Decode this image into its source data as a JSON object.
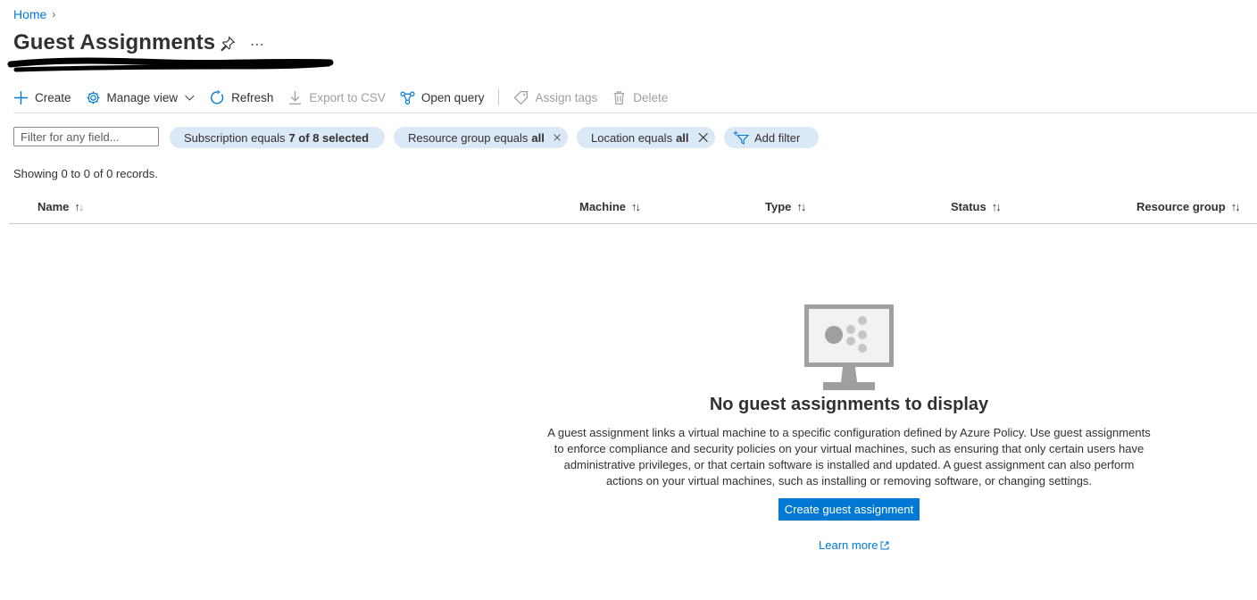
{
  "breadcrumb": {
    "home": "Home"
  },
  "page": {
    "title": "Guest Assignments"
  },
  "toolbar": {
    "create": "Create",
    "manage_view": "Manage view",
    "refresh": "Refresh",
    "export_csv": "Export to CSV",
    "open_query": "Open query",
    "assign_tags": "Assign tags",
    "delete": "Delete"
  },
  "filters": {
    "placeholder": "Filter for any field...",
    "subscription": {
      "label": "Subscription equals",
      "value": "7 of 8 selected"
    },
    "resource_group": {
      "label": "Resource group equals",
      "value": "all"
    },
    "location": {
      "label": "Location equals",
      "value": "all"
    },
    "add_filter": "Add filter"
  },
  "records": "Showing 0 to 0 of 0 records.",
  "table": {
    "columns": [
      "Name",
      "Machine",
      "Type",
      "Status",
      "Resource group"
    ],
    "rows": []
  },
  "empty_state": {
    "title": "No guest assignments to display",
    "description": "A guest assignment links a virtual machine to a specific configuration defined by Azure Policy. Use guest assignments to enforce compliance and security policies on your virtual machines, such as ensuring that only certain users have administrative privileges, or that certain software is installed and updated. A guest assignment can also perform actions on your virtual machines, such as installing or removing software, or changing settings.",
    "button": "Create guest assignment",
    "learn_more": "Learn more"
  },
  "colors": {
    "accent": "#0078d4",
    "pill_bg": "#dbe8f5",
    "disabled": "#a19f9d"
  }
}
